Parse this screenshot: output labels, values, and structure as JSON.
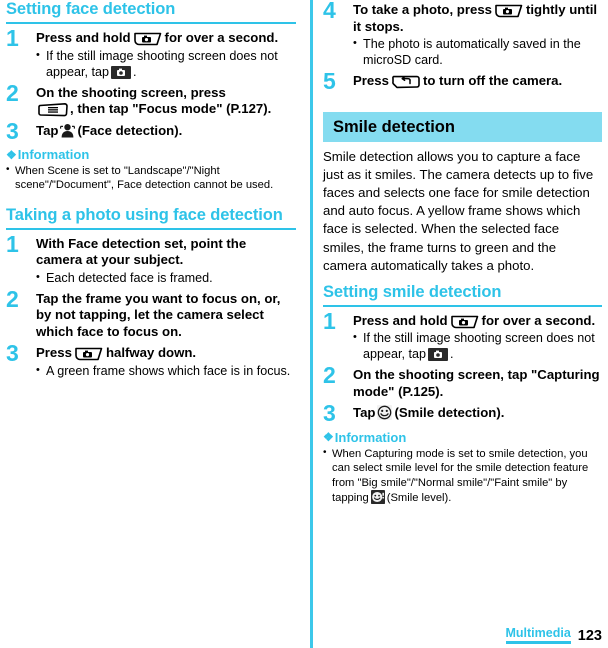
{
  "document": {
    "page_number": "123",
    "footer_label": "Multimedia"
  },
  "colors": {
    "accent_cyan": "#2ec3e8",
    "band_cyan": "#84dcf0",
    "text_black": "#000000"
  },
  "left_column": {
    "section1": {
      "title": "Setting face detection",
      "steps": [
        {
          "number": "1",
          "text_before_key": "Press and hold",
          "key_icon": "camera-key-icon",
          "text_after_key": "for over a second.",
          "bullets": [
            {
              "text_before_icon": "If the still image shooting screen does not appear, tap",
              "icon": "camera-app-icon",
              "text_after_icon": "."
            }
          ]
        },
        {
          "number": "2",
          "text_before_key": "On the shooting screen, press",
          "key_icon": "menu-key-icon",
          "text_after_key": ", then tap \"Focus mode\" (P.127).",
          "bullets": []
        },
        {
          "number": "3",
          "text_before_key": "Tap",
          "key_icon": "face-detection-icon",
          "text_after_key": "(Face detection).",
          "bullets": []
        }
      ],
      "information": {
        "heading": "Information",
        "items": [
          "When Scene is set to \"Landscape\"/\"Night scene\"/\"Document\", Face detection cannot be used."
        ]
      }
    },
    "section2": {
      "title": "Taking a photo using face detection",
      "steps": [
        {
          "number": "1",
          "text_before_key": "With Face detection set, point the camera at your subject.",
          "key_icon": "",
          "text_after_key": "",
          "bullets": [
            {
              "text_before_icon": "Each detected face is framed.",
              "icon": "",
              "text_after_icon": ""
            }
          ]
        },
        {
          "number": "2",
          "text_before_key": "Tap the frame you want to focus on, or, by not tapping, let the camera select which face to focus on.",
          "key_icon": "",
          "text_after_key": "",
          "bullets": []
        },
        {
          "number": "3",
          "text_before_key": "Press",
          "key_icon": "camera-key-icon",
          "text_after_key": "halfway down.",
          "bullets": [
            {
              "text_before_icon": "A green frame shows which face is in focus.",
              "icon": "",
              "text_after_icon": ""
            }
          ]
        }
      ]
    }
  },
  "right_column": {
    "continued_steps": [
      {
        "number": "4",
        "text_before_key": "To take a photo, press",
        "key_icon": "camera-key-icon",
        "text_after_key": "tightly until it stops.",
        "bullets": [
          {
            "text_before_icon": "The photo is automatically saved in the microSD card.",
            "icon": "",
            "text_after_icon": ""
          }
        ]
      },
      {
        "number": "5",
        "text_before_key": "Press",
        "key_icon": "back-key-icon",
        "text_after_key": "to turn off the camera.",
        "bullets": []
      }
    ],
    "banner": {
      "title": "Smile detection"
    },
    "intro_paragraph": "Smile detection allows you to capture a face just as it smiles. The camera detects up to five faces and selects one face for smile detection and auto focus. A yellow frame shows which face is selected. When the selected face smiles, the frame turns to green and the camera automatically takes a photo.",
    "section": {
      "title": "Setting smile detection",
      "steps": [
        {
          "number": "1",
          "text_before_key": "Press and hold",
          "key_icon": "camera-key-icon",
          "text_after_key": "for over a second.",
          "bullets": [
            {
              "text_before_icon": "If the still image shooting screen does not appear, tap",
              "icon": "camera-app-icon",
              "text_after_icon": "."
            }
          ]
        },
        {
          "number": "2",
          "text_before_key": "On the shooting screen, tap \"Capturing mode\" (P.125).",
          "key_icon": "",
          "text_after_key": "",
          "bullets": []
        },
        {
          "number": "3",
          "text_before_key": "Tap",
          "key_icon": "smile-detection-icon",
          "text_after_key": "(Smile detection).",
          "bullets": []
        }
      ],
      "information": {
        "heading": "Information",
        "items_parts": {
          "part1": "When Capturing mode is set to smile detection, you can select smile level for the smile detection feature from \"Big smile\"/\"Normal smile\"/\"Faint smile\" by tapping",
          "icon": "smile-level-icon",
          "part2": "(Smile level)."
        }
      }
    }
  }
}
